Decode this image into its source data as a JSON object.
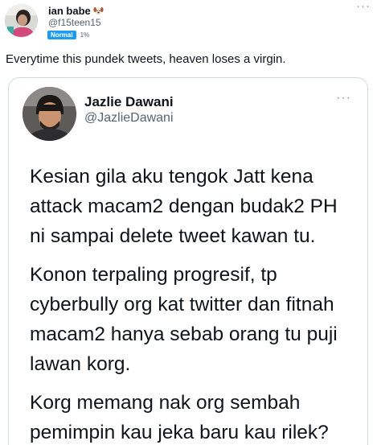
{
  "post": {
    "display_name": "ian babe",
    "name_emoji": "dog-face-emoji",
    "handle": "@f15teen15",
    "badge_label": "Normal",
    "badge_percent": "1%",
    "more_icon": "more-horizontal-icon",
    "text": "Everytime this pundek tweets, heaven loses a virgin."
  },
  "quoted": {
    "display_name": "Jazlie Dawani",
    "handle": "@JazlieDawani",
    "more_icon": "more-horizontal-icon",
    "paragraphs": [
      "Kesian gila aku tengok Jatt kena\nattack macam2 dengan budak2 PH\nni sampai delete tweet kawan tu.",
      "Konon terpaling progresif, tp\ncyberbully org kat twitter dan fitnah\nmacam2 hanya sebab orang tu puji\nlawan korg.",
      "Korg memang nak org sembah\npemimpin kau jeka baru kau rilek?"
    ]
  },
  "colors": {
    "text_primary": "#0f1419",
    "text_secondary": "#536471",
    "badge_blue": "#1d9bf0",
    "card_border": "#cfd9de"
  }
}
